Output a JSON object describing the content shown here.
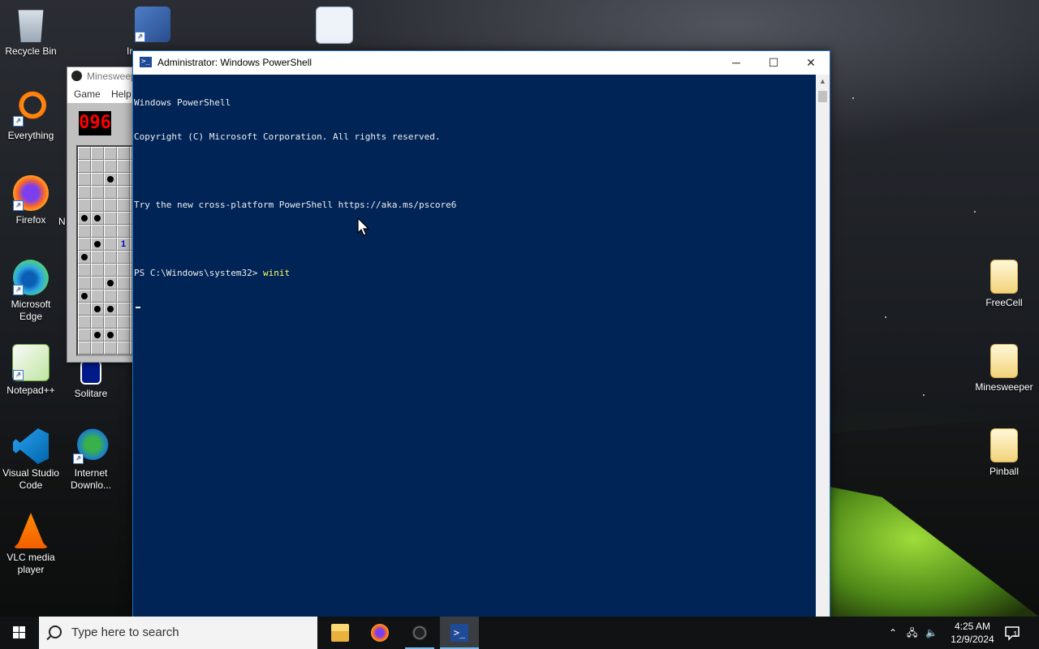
{
  "desktop": {
    "left_icons": [
      {
        "label": "Recycle Bin"
      },
      {
        "label": "Everything"
      },
      {
        "label": "Firefox"
      },
      {
        "label": "Microsoft Edge"
      },
      {
        "label": "Notepad++"
      },
      {
        "label": "Visual Studio Code"
      },
      {
        "label": "VLC media player"
      }
    ],
    "second_col": [
      {
        "label": "Solitare"
      },
      {
        "label": "Internet Downlo..."
      }
    ],
    "partial_labels": {
      "ie": "Ir",
      "n": "N"
    },
    "right_icons": [
      {
        "label": "FreeCell"
      },
      {
        "label": "Minesweeper"
      },
      {
        "label": "Pinball"
      }
    ]
  },
  "minesweeper": {
    "title": "Minesweeper",
    "menu": [
      "Game",
      "Help"
    ],
    "counter": "096",
    "number_cell": "1"
  },
  "powershell": {
    "title": "Administrator: Windows PowerShell",
    "lines": [
      "Windows PowerShell",
      "Copyright (C) Microsoft Corporation. All rights reserved.",
      "",
      "Try the new cross-platform PowerShell https://aka.ms/pscore6",
      ""
    ],
    "prompt": "PS C:\\Windows\\system32> ",
    "command": "winit",
    "controls": {
      "minimize": "─",
      "maximize": "☐",
      "close": "✕"
    }
  },
  "taskbar": {
    "search_placeholder": "Type here to search",
    "apps": [
      "file-explorer",
      "firefox",
      "minesweeper",
      "powershell"
    ],
    "clock": {
      "time": "4:25 AM",
      "date": "12/9/2024"
    },
    "notification_count": "1"
  }
}
